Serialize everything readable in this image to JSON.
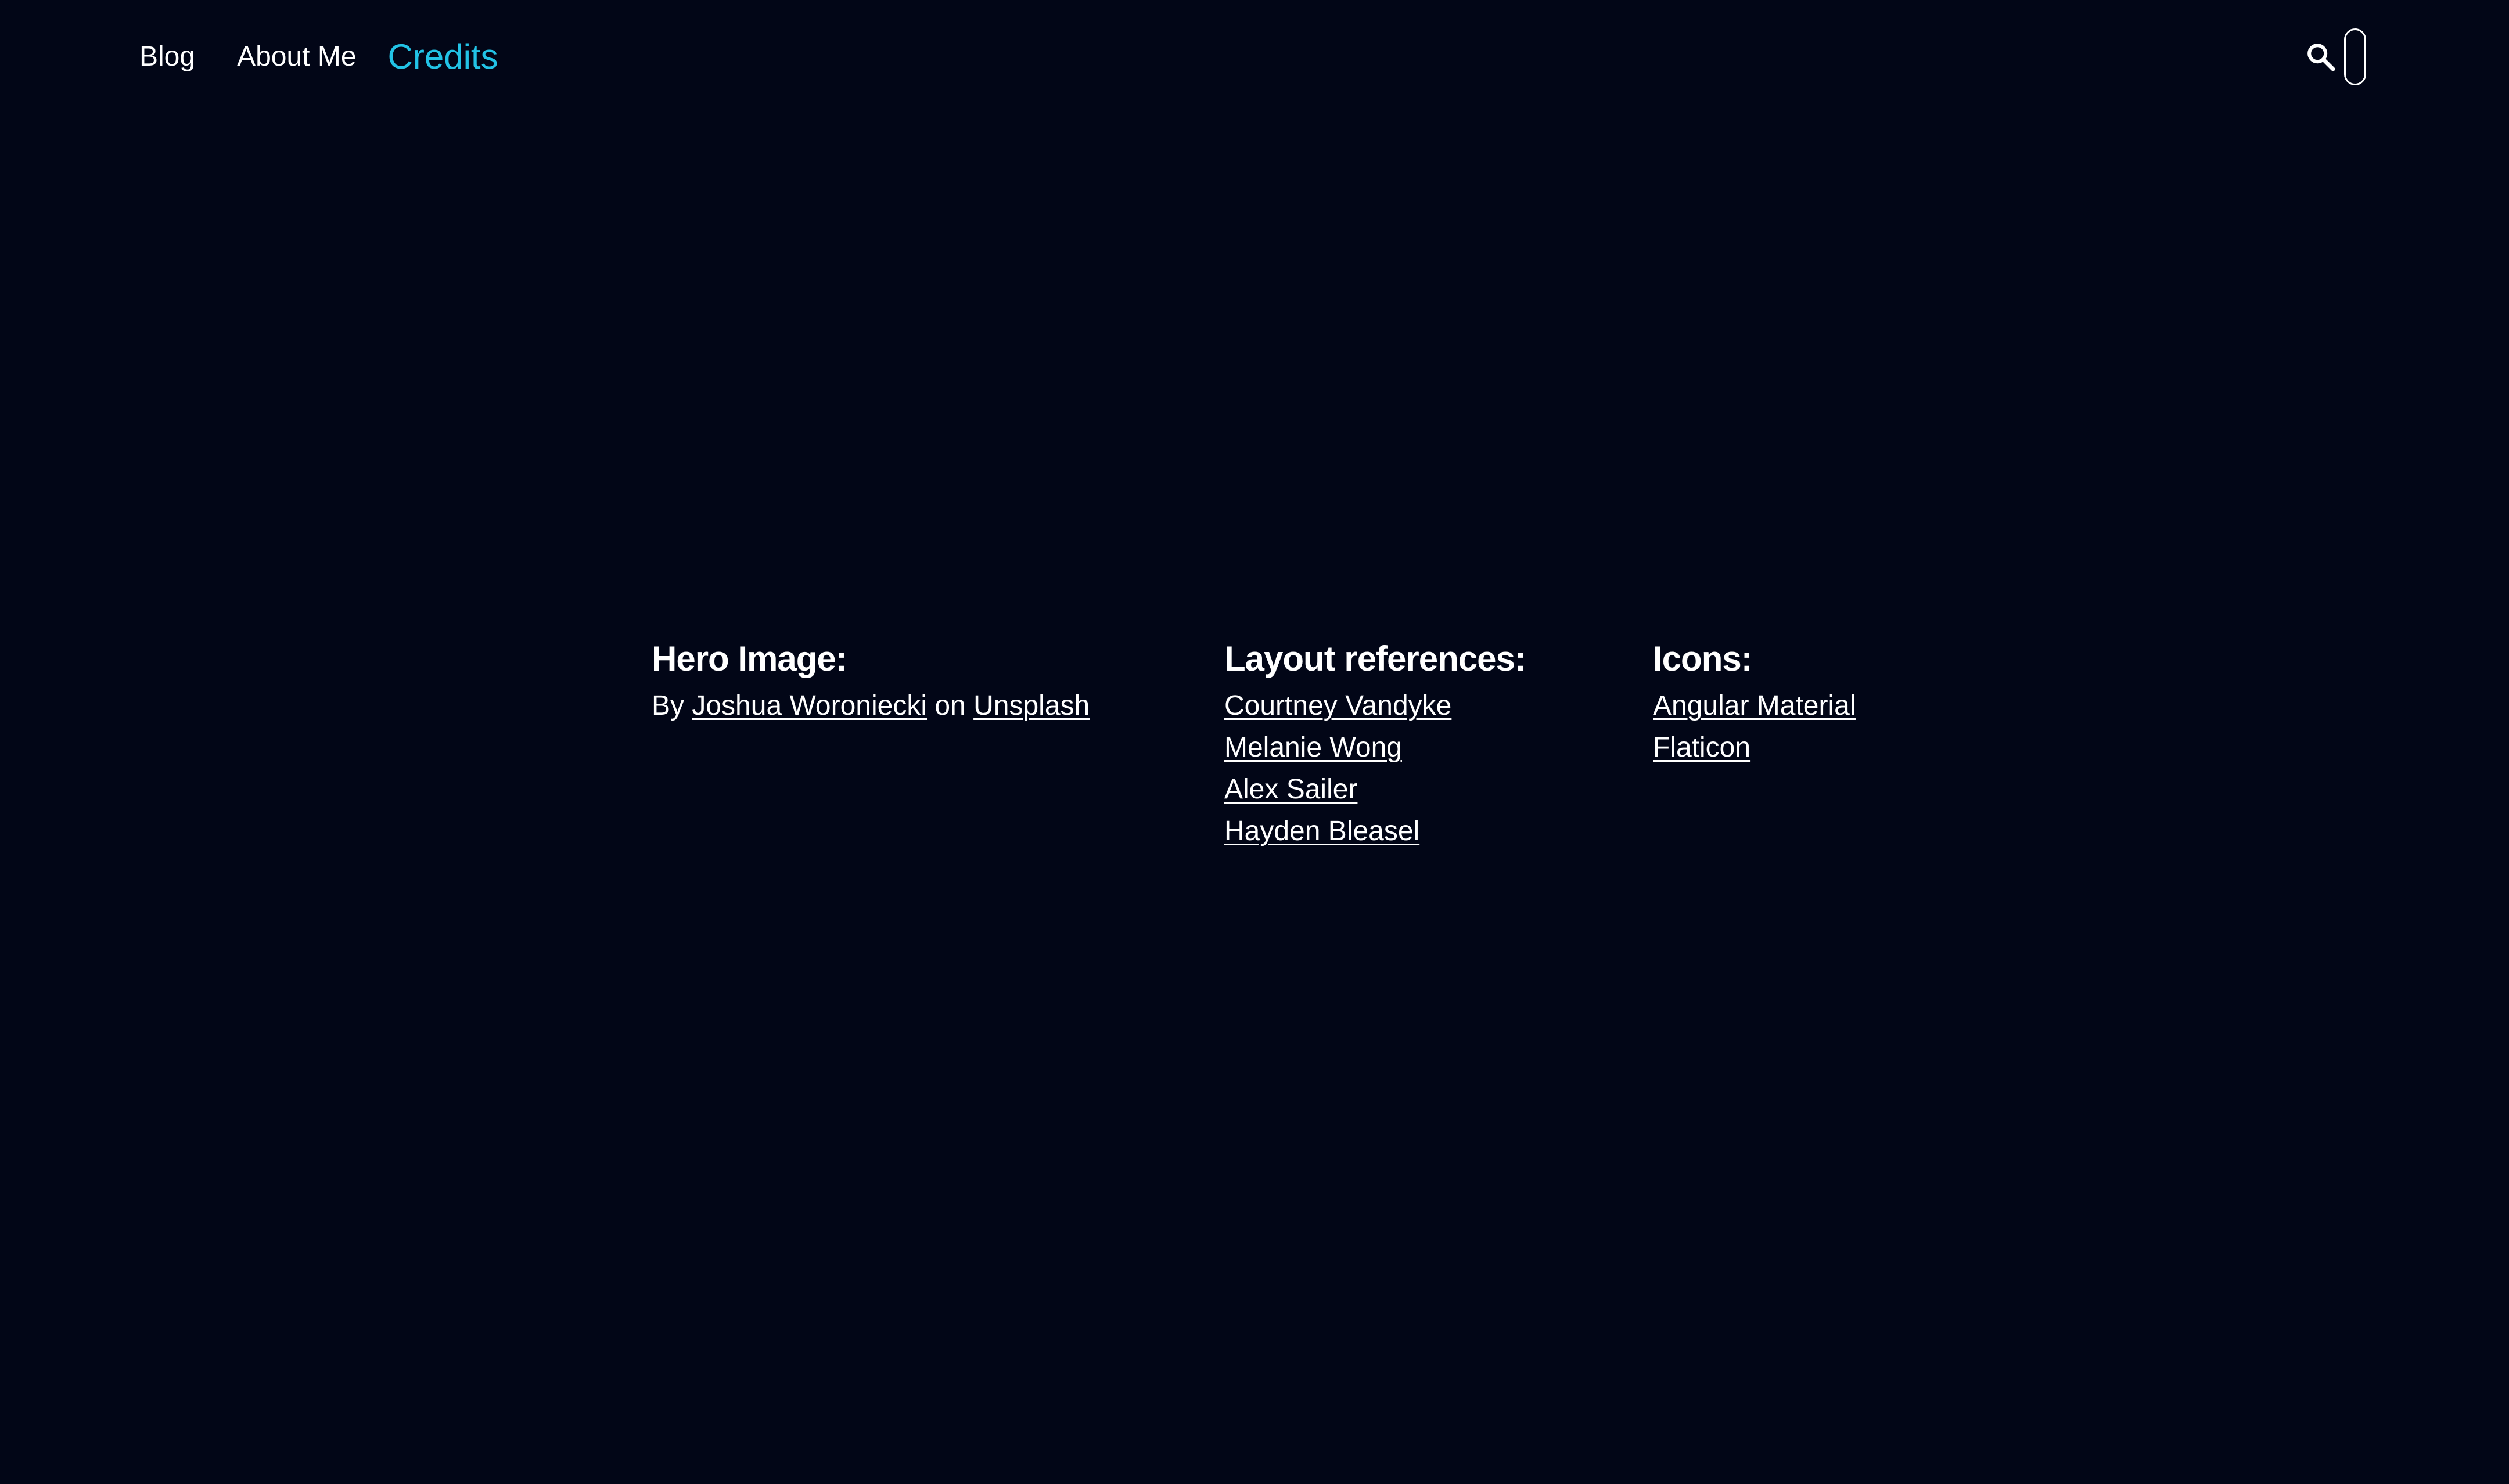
{
  "nav": {
    "blog": "Blog",
    "about": "About Me",
    "credits": "Credits"
  },
  "header": {
    "search_icon": "search-icon",
    "toggle": "theme-toggle"
  },
  "colors": {
    "background": "#020617",
    "accent": "#22c3e6",
    "text": "#ffffff"
  },
  "hero": {
    "heading": "Hero Image:",
    "by_prefix": "By",
    "author": "Joshua Woroniecki",
    "on_word": "on",
    "source": "Unsplash"
  },
  "layout": {
    "heading": "Layout references:",
    "items": [
      "Courtney Vandyke",
      "Melanie Wong",
      "Alex Sailer",
      "Hayden Bleasel"
    ]
  },
  "icons": {
    "heading": "Icons:",
    "items": [
      "Angular Material",
      "Flaticon"
    ]
  }
}
